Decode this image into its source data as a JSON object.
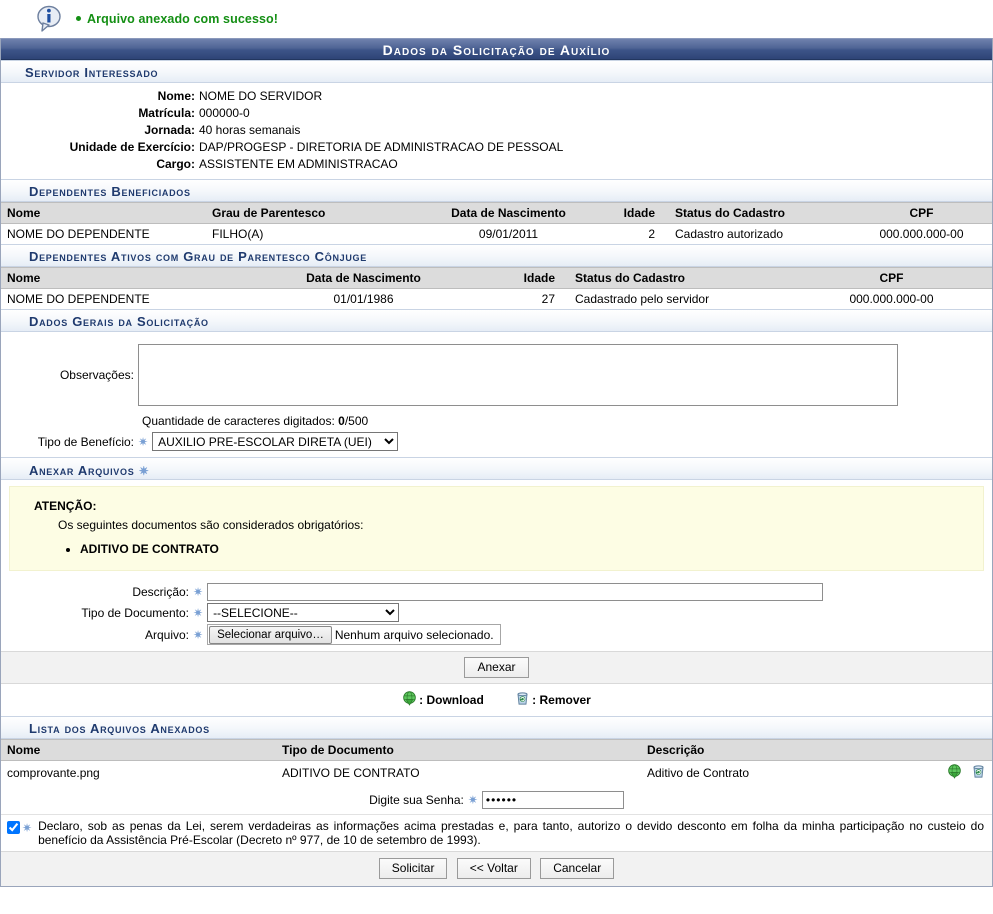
{
  "message": {
    "icon": "info-bubble-icon",
    "text": "Arquivo anexado com sucesso!"
  },
  "title": "Dados da Solicitação de Auxílio",
  "sections": {
    "servidor": {
      "header": "Servidor Interessado",
      "fields": [
        {
          "label": "Nome:",
          "value": "NOME DO SERVIDOR"
        },
        {
          "label": "Matrícula:",
          "value": "000000-0"
        },
        {
          "label": "Jornada:",
          "value": "40 horas semanais"
        },
        {
          "label": "Unidade de Exercício:",
          "value": "DAP/PROGESP - DIRETORIA DE ADMINISTRACAO DE PESSOAL"
        },
        {
          "label": "Cargo:",
          "value": "ASSISTENTE EM ADMINISTRACAO"
        }
      ]
    },
    "dependentes_beneficiados": {
      "header": "Dependentes Beneficiados",
      "columns": [
        "Nome",
        "Grau de Parentesco",
        "Data de Nascimento",
        "Idade",
        "Status do Cadastro",
        "CPF"
      ],
      "rows": [
        {
          "nome": "NOME DO DEPENDENTE",
          "grau": "FILHO(A)",
          "nascimento": "09/01/2011",
          "idade": "2",
          "status": "Cadastro autorizado",
          "cpf": "000.000.000-00"
        }
      ]
    },
    "dependentes_conjuge": {
      "header": "Dependentes Ativos com Grau de Parentesco Cônjuge",
      "columns": [
        "Nome",
        "Data de Nascimento",
        "Idade",
        "Status do Cadastro",
        "CPF"
      ],
      "rows": [
        {
          "nome": "NOME DO DEPENDENTE",
          "nascimento": "01/01/1986",
          "idade": "27",
          "status": "Cadastrado pelo servidor",
          "cpf": "000.000.000-00"
        }
      ]
    },
    "dados_gerais": {
      "header": "Dados Gerais da Solicitação",
      "observacoes_label": "Observações:",
      "observacoes_value": "",
      "contador_prefix": "Quantidade de caracteres digitados:",
      "contador_atual": "0",
      "contador_max": "/500",
      "tipo_beneficio_label": "Tipo de Benefício:",
      "tipo_beneficio_value": "AUXILIO PRE-ESCOLAR DIRETA (UEI)",
      "tipo_beneficio_options": [
        "AUXILIO PRE-ESCOLAR DIRETA (UEI)"
      ]
    },
    "anexar": {
      "header": "Anexar Arquivos",
      "warning_title": "ATENÇÃO:",
      "warning_subtitle": "Os seguintes documentos são considerados obrigatórios:",
      "warning_items": [
        "ADITIVO DE CONTRATO"
      ],
      "descricao_label": "Descrição:",
      "descricao_value": "",
      "tipo_documento_label": "Tipo de Documento:",
      "tipo_documento_value": "--SELECIONE--",
      "tipo_documento_options": [
        "--SELECIONE--"
      ],
      "arquivo_label": "Arquivo:",
      "arquivo_button": "Selecionar arquivo…",
      "arquivo_status": "Nenhum arquivo selecionado.",
      "anexar_button": "Anexar"
    },
    "legend": {
      "download_label": ": Download",
      "remover_label": ": Remover",
      "download_icon": "download-globe-icon",
      "remover_icon": "trash-bin-icon"
    },
    "lista_anexos": {
      "header": "Lista dos Arquivos Anexados",
      "columns": [
        "Nome",
        "Tipo de Documento",
        "Descrição"
      ],
      "rows": [
        {
          "nome": "comprovante.png",
          "tipo": "ADITIVO DE CONTRATO",
          "descricao": "Aditivo de Contrato"
        }
      ]
    },
    "senha": {
      "label": "Digite sua Senha:",
      "value": "••••••"
    },
    "declaracao": {
      "checked": true,
      "text": "Declaro, sob as penas da Lei, serem verdadeiras as informações acima prestadas e, para tanto, autorizo o devido desconto em folha da minha participação no custeio do benefício da Assistência Pré-Escolar (Decreto nº 977, de 10 de setembro de 1993)."
    },
    "footer": {
      "solicitar": "Solicitar",
      "voltar": "<< Voltar",
      "cancelar": "Cancelar"
    }
  },
  "colors": {
    "titlebar_dark": "#2e4476",
    "titlebar_light": "#6f81ad",
    "success_green": "#148f14",
    "subheader_text": "#1f3a6e",
    "star_blue": "#7aa0d4",
    "warning_bg": "#fdfde4",
    "table_header_bg": "#dcdcdc"
  }
}
